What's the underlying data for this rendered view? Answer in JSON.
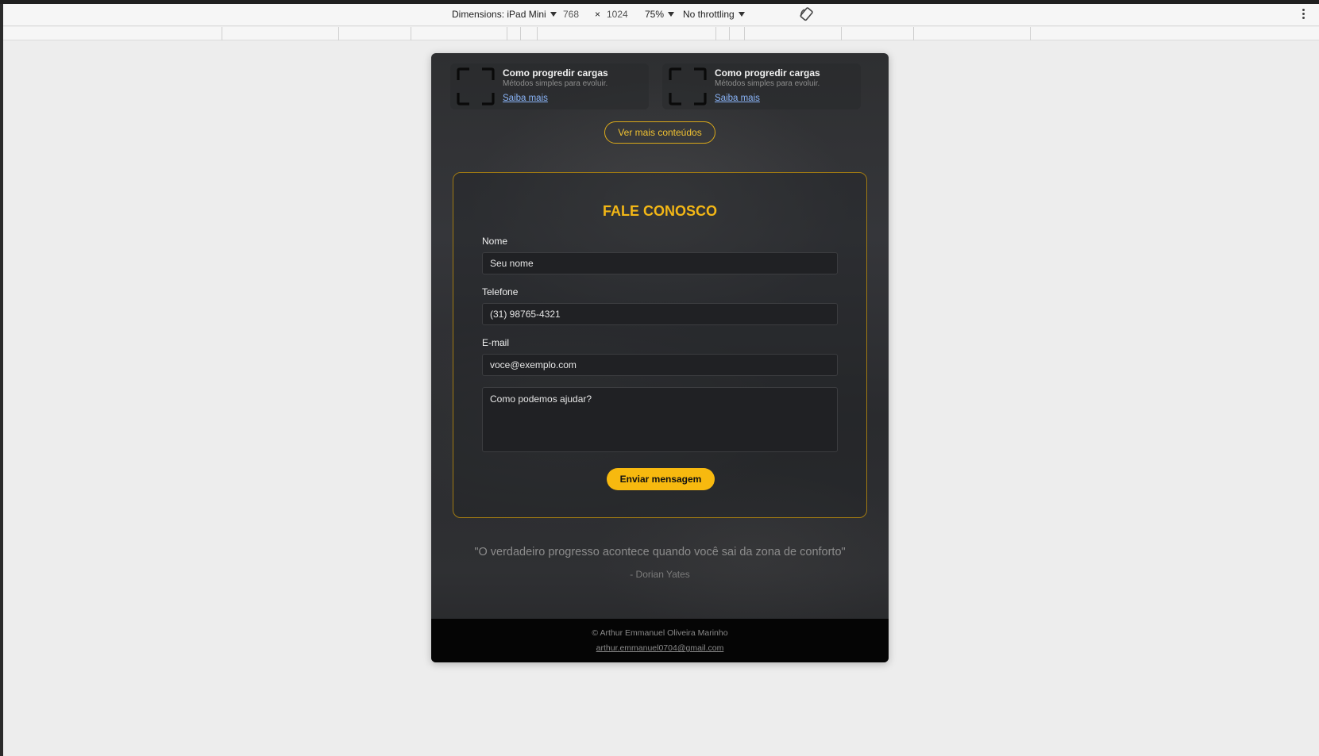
{
  "devtools": {
    "dimensions_label": "Dimensions: iPad Mini",
    "width_value": "768",
    "times_sign": "×",
    "height_value": "1024",
    "zoom": "75%",
    "throttling": "No throttling",
    "rotate_icon": "rotate-icon",
    "more_icon": "kebab-icon"
  },
  "cards": [
    {
      "title": "Como progredir cargas",
      "description": "Métodos simples para evoluir.",
      "link": "Saiba mais",
      "icon": "frame-icon"
    },
    {
      "title": "Como progredir cargas",
      "description": "Métodos simples para evoluir.",
      "link": "Saiba mais",
      "icon": "frame-icon"
    }
  ],
  "more_button": "Ver mais conteúdos",
  "contact": {
    "title": "FALE CONOSCO",
    "name_label": "Nome",
    "name_placeholder": "Seu nome",
    "phone_label": "Telefone",
    "phone_placeholder": "(31) 98765-4321",
    "email_label": "E-mail",
    "email_placeholder": "voce@exemplo.com",
    "message_placeholder": "Como podemos ajudar?",
    "submit": "Enviar mensagem"
  },
  "quote": {
    "text": "\"O verdadeiro progresso acontece quando você sai da zona de conforto\"",
    "author": "- Dorian Yates"
  },
  "footer": {
    "copyright": "© Arthur Emmanuel Oliveira Marinho",
    "email": "arthur.emmanuel0704@gmail.com"
  },
  "colors": {
    "accent": "#f7b90f",
    "link": "#8ab4f8",
    "page_bg": "#2e2f31"
  }
}
